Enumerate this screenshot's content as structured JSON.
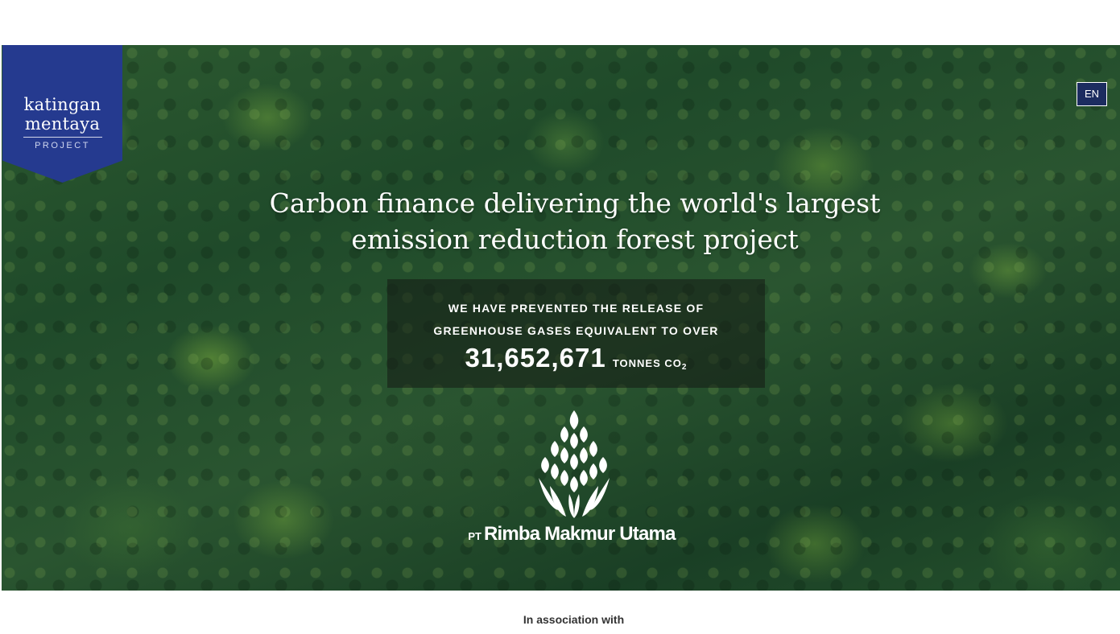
{
  "logo": {
    "line1": "katingan",
    "line2": "mentaya",
    "line3": "PROJECT",
    "color": "#253a8f"
  },
  "language_button": {
    "label": "EN"
  },
  "hero": {
    "headline_line1": "Carbon finance delivering the world's largest",
    "headline_line2": "emission reduction forest project"
  },
  "stats": {
    "line1": "WE HAVE PREVENTED THE RELEASE OF",
    "line2": "GREENHOUSE GASES EQUIVALENT TO OVER",
    "value": "31,652,671",
    "unit": "TONNES CO",
    "unit_subscript": "2"
  },
  "company": {
    "prefix": "PT",
    "name": "Rimba Makmur Utama",
    "emblem_icon": "leaf-flame-emblem-icon"
  },
  "footer": {
    "association_label": "In association with"
  }
}
